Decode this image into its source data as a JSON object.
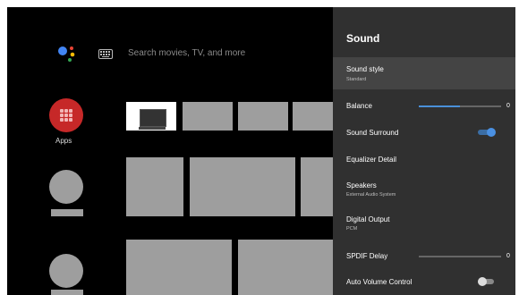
{
  "search": {
    "placeholder": "Search movies, TV, and more"
  },
  "apps": {
    "label": "Apps"
  },
  "sound_panel": {
    "title": "Sound",
    "items": [
      {
        "label": "Sound style",
        "sub": "Standard"
      },
      {
        "label": "Balance",
        "value": "0",
        "slider_fraction": 0.5
      },
      {
        "label": "Sound Surround",
        "toggle": "on"
      },
      {
        "label": "Equalizer Detail"
      },
      {
        "label": "Speakers",
        "sub": "External Audio System"
      },
      {
        "label": "Digital Output",
        "sub": "PCM"
      },
      {
        "label": "SPDIF Delay",
        "value": "0",
        "slider_fraction": 0.0
      },
      {
        "label": "Auto Volume Control",
        "toggle": "off"
      }
    ]
  },
  "colors": {
    "background": "#000000",
    "panel": "#303030",
    "panel_selected": "#444444",
    "accent": "#4a90e2",
    "apps_icon": "#c62828",
    "tile_placeholder": "#9e9e9e"
  },
  "icons": [
    "google-assistant-icon",
    "keyboard-icon",
    "apps-grid-icon",
    "tv-icon"
  ]
}
